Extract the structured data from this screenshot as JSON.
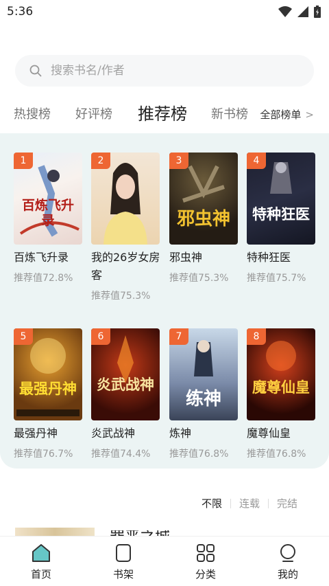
{
  "status": {
    "time": "5:36"
  },
  "search": {
    "placeholder": "搜索书名/作者"
  },
  "tabs": [
    {
      "label": "热搜榜",
      "active": false
    },
    {
      "label": "好评榜",
      "active": false
    },
    {
      "label": "推荐榜",
      "active": true
    },
    {
      "label": "新书榜",
      "active": false
    }
  ],
  "all_ranks": {
    "label": "全部榜单",
    "arrow": ">"
  },
  "books": [
    {
      "rank": "1",
      "title": "百炼飞升录",
      "score": "推荐值72.8%",
      "cover_text": "百炼飞升录"
    },
    {
      "rank": "2",
      "title": "我的26岁女房客",
      "score": "推荐值75.3%",
      "cover_text": ""
    },
    {
      "rank": "3",
      "title": "邪虫神",
      "score": "推荐值75.3%",
      "cover_text": "邪虫神"
    },
    {
      "rank": "4",
      "title": "特种狂医",
      "score": "推荐值75.7%",
      "cover_text": "特种狂医"
    },
    {
      "rank": "5",
      "title": "最强丹神",
      "score": "推荐值76.7%",
      "cover_text": "最强丹神"
    },
    {
      "rank": "6",
      "title": "炎武战神",
      "score": "推荐值74.4%",
      "cover_text": "炎武战神"
    },
    {
      "rank": "7",
      "title": "炼神",
      "score": "推荐值76.8%",
      "cover_text": "练神"
    },
    {
      "rank": "8",
      "title": "魔尊仙皇",
      "score": "推荐值76.8%",
      "cover_text": "魔尊仙皇"
    }
  ],
  "filters": [
    {
      "label": "不限",
      "active": true
    },
    {
      "label": "连载",
      "active": false
    },
    {
      "label": "完结",
      "active": false
    }
  ],
  "partial": {
    "title": "罪恶之城"
  },
  "nav": [
    {
      "label": "首页",
      "icon": "home-icon",
      "active": true
    },
    {
      "label": "书架",
      "icon": "bookshelf-icon",
      "active": false
    },
    {
      "label": "分类",
      "icon": "category-icon",
      "active": false
    },
    {
      "label": "我的",
      "icon": "profile-icon",
      "active": false
    }
  ],
  "colors": {
    "accent": "#ee6633",
    "panel": "#ecf4f4",
    "home_icon": "#66c6c6"
  }
}
